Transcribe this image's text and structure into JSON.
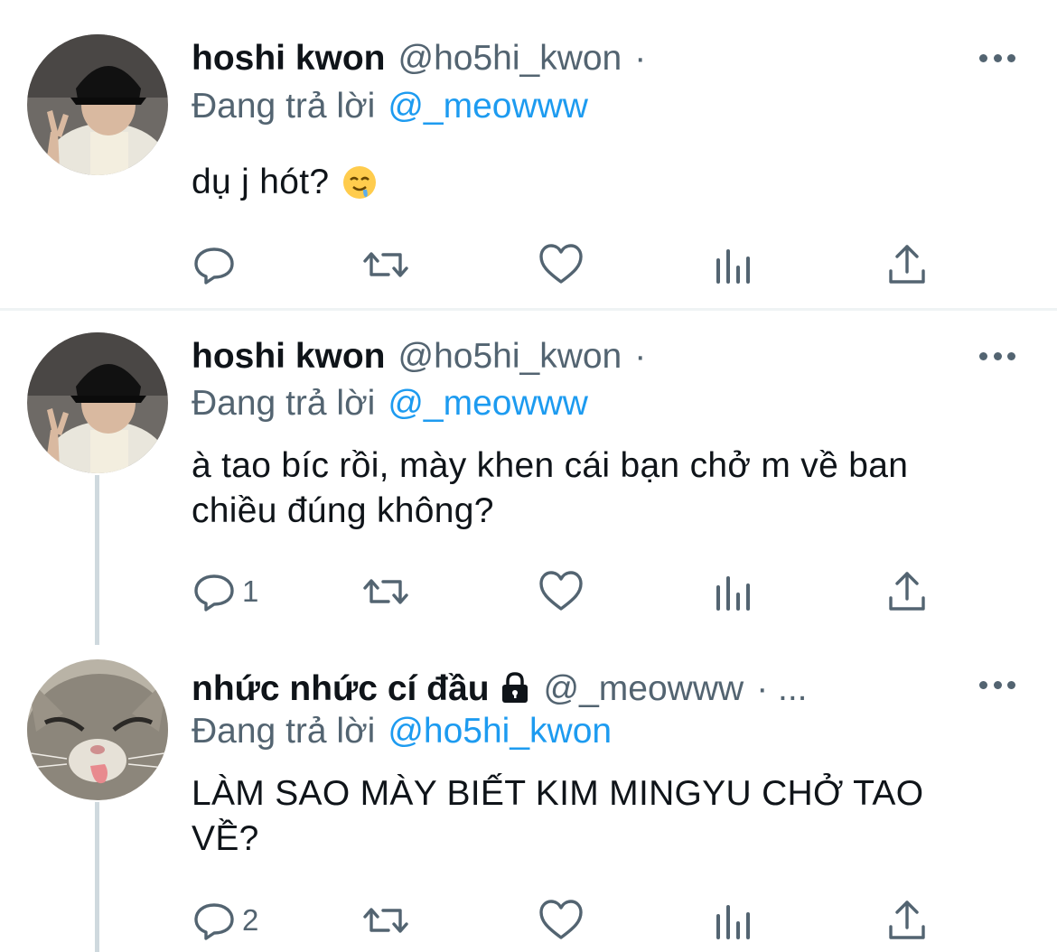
{
  "tweets": [
    {
      "name": "hoshi kwon",
      "handle": "@ho5hi_kwon",
      "separator": "·",
      "reply_prefix": "Đang trả lời",
      "reply_to": "@_meowww",
      "text": "dụ j hót?",
      "emoji": "drooling-face",
      "reply_count": ""
    },
    {
      "name": "hoshi kwon",
      "handle": "@ho5hi_kwon",
      "separator": "·",
      "reply_prefix": "Đang trả lời",
      "reply_to": "@_meowww",
      "text_line1": "à tao bíc rồi, mày khen cái bạn chở m về ban",
      "text_line2": "chiều đúng không?",
      "reply_count": "1"
    },
    {
      "name": "nhức nhức cí đầu",
      "handle": "@_meowww",
      "separator": "· ...",
      "protected_icon": "lock-icon",
      "reply_prefix": "Đang trả lời",
      "reply_to": "@ho5hi_kwon",
      "text_line1": "LÀM SAO MÀY BIẾT KIM MINGYU CHỞ TAO",
      "text_line2": "VỀ?",
      "reply_count": "2"
    }
  ],
  "icons": {
    "reply": "comment-icon",
    "retweet": "retweet-icon",
    "like": "heart-icon",
    "views": "analytics-icon",
    "share": "share-icon",
    "more": "more-options-icon"
  },
  "colors": {
    "accent": "#1d9bf0",
    "secondary_text": "#536471",
    "primary_text": "#0f1419",
    "divider": "#eff3f4",
    "thread_line": "#cfd9de"
  }
}
